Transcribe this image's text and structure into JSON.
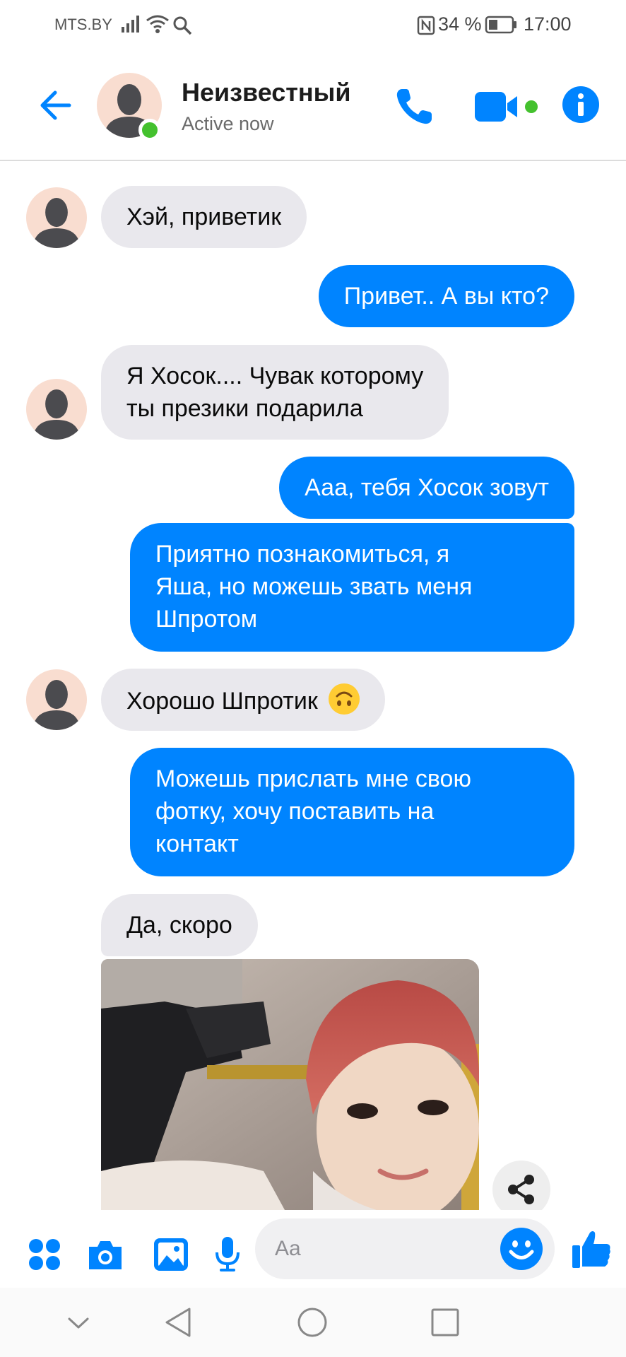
{
  "status_bar": {
    "carrier": "MTS.BY",
    "battery_percent": "34 %",
    "time": "17:00",
    "icons": [
      "signal-icon",
      "wifi-icon",
      "search-icon",
      "nfc-icon",
      "battery-icon"
    ]
  },
  "header": {
    "contact_name": "Неизвестный",
    "status": "Active now",
    "online": true,
    "accent_color": "#0084ff",
    "online_color": "#44c12e"
  },
  "messages": [
    {
      "direction": "in",
      "text_lines": [
        "Хэй, приветик"
      ]
    },
    {
      "direction": "out",
      "text_lines": [
        "Привет..  А вы кто?"
      ]
    },
    {
      "direction": "in",
      "text_lines": [
        "Я Хосок.... Чувак которому",
        "ты презики подарила"
      ]
    },
    {
      "direction": "out",
      "text_lines": [
        "Ааа, тебя Хосок зовут"
      ]
    },
    {
      "direction": "out",
      "text_lines": [
        "Приятно познакомиться, я",
        "Яша, но можешь звать меня",
        "Шпротом"
      ]
    },
    {
      "direction": "in",
      "text_lines": [
        "Хорошо Шпротик"
      ],
      "emoji": "upside-down-face"
    },
    {
      "direction": "out",
      "text_lines": [
        "Можешь прислать мне свою",
        "фотку, хочу поставить на",
        "контакт"
      ]
    },
    {
      "direction": "in",
      "text_lines": [
        "Да, скоро"
      ]
    },
    {
      "direction": "in",
      "type": "photo",
      "description_icon": "photo-attachment"
    }
  ],
  "composer": {
    "placeholder": "Aa",
    "buttons": [
      "more-icon",
      "camera-icon",
      "gallery-icon",
      "mic-icon",
      "emoji-icon",
      "like-icon"
    ]
  },
  "bubble_colors": {
    "incoming_bg": "#e9e8ed",
    "outgoing_bg": "#0084ff"
  }
}
